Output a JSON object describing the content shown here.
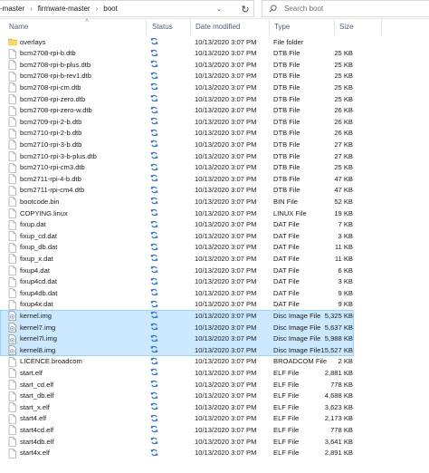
{
  "address_bar": {
    "crumbs": [
      "-master",
      "firmware-master",
      "boot"
    ],
    "separator": "›"
  },
  "search": {
    "placeholder": "Search boot"
  },
  "columns": {
    "name": "Name",
    "status": "Status",
    "date": "Date modified",
    "type": "Type",
    "size": "Size"
  },
  "colors": {
    "selection_bg": "#cce8ff",
    "selection_border": "#99d1ff",
    "folder": "#f4c64c",
    "sync_blue": "#2b6dd0"
  },
  "files": [
    {
      "name": "overlays",
      "date": "10/13/2020 3:07 PM",
      "type": "File folder",
      "size": "",
      "icon": "folder-icon",
      "selected": false
    },
    {
      "name": "bcm2708-rpi-b.dtb",
      "date": "10/13/2020 3:07 PM",
      "type": "DTB File",
      "size": "25 KB",
      "icon": "file-icon",
      "selected": false
    },
    {
      "name": "bcm2708-rpi-b-plus.dtb",
      "date": "10/13/2020 3:07 PM",
      "type": "DTB File",
      "size": "25 KB",
      "icon": "file-icon",
      "selected": false
    },
    {
      "name": "bcm2708-rpi-b-rev1.dtb",
      "date": "10/13/2020 3:07 PM",
      "type": "DTB File",
      "size": "25 KB",
      "icon": "file-icon",
      "selected": false
    },
    {
      "name": "bcm2708-rpi-cm.dtb",
      "date": "10/13/2020 3:07 PM",
      "type": "DTB File",
      "size": "25 KB",
      "icon": "file-icon",
      "selected": false
    },
    {
      "name": "bcm2708-rpi-zero.dtb",
      "date": "10/13/2020 3:07 PM",
      "type": "DTB File",
      "size": "25 KB",
      "icon": "file-icon",
      "selected": false
    },
    {
      "name": "bcm2708-rpi-zero-w.dtb",
      "date": "10/13/2020 3:07 PM",
      "type": "DTB File",
      "size": "26 KB",
      "icon": "file-icon",
      "selected": false
    },
    {
      "name": "bcm2709-rpi-2-b.dtb",
      "date": "10/13/2020 3:07 PM",
      "type": "DTB File",
      "size": "26 KB",
      "icon": "file-icon",
      "selected": false
    },
    {
      "name": "bcm2710-rpi-2-b.dtb",
      "date": "10/13/2020 3:07 PM",
      "type": "DTB File",
      "size": "26 KB",
      "icon": "file-icon",
      "selected": false
    },
    {
      "name": "bcm2710-rpi-3-b.dtb",
      "date": "10/13/2020 3:07 PM",
      "type": "DTB File",
      "size": "27 KB",
      "icon": "file-icon",
      "selected": false
    },
    {
      "name": "bcm2710-rpi-3-b-plus.dtb",
      "date": "10/13/2020 3:07 PM",
      "type": "DTB File",
      "size": "27 KB",
      "icon": "file-icon",
      "selected": false
    },
    {
      "name": "bcm2710-rpi-cm3.dtb",
      "date": "10/13/2020 3:07 PM",
      "type": "DTB File",
      "size": "25 KB",
      "icon": "file-icon",
      "selected": false
    },
    {
      "name": "bcm2711-rpi-4-b.dtb",
      "date": "10/13/2020 3:07 PM",
      "type": "DTB File",
      "size": "47 KB",
      "icon": "file-icon",
      "selected": false
    },
    {
      "name": "bcm2711-rpi-cm4.dtb",
      "date": "10/13/2020 3:07 PM",
      "type": "DTB File",
      "size": "47 KB",
      "icon": "file-icon",
      "selected": false
    },
    {
      "name": "bootcode.bin",
      "date": "10/13/2020 3:07 PM",
      "type": "BIN File",
      "size": "52 KB",
      "icon": "file-icon",
      "selected": false
    },
    {
      "name": "COPYING.linux",
      "date": "10/13/2020 3:07 PM",
      "type": "LINUX File",
      "size": "19 KB",
      "icon": "file-icon",
      "selected": false
    },
    {
      "name": "fixup.dat",
      "date": "10/13/2020 3:07 PM",
      "type": "DAT File",
      "size": "7 KB",
      "icon": "file-icon",
      "selected": false
    },
    {
      "name": "fixup_cd.dat",
      "date": "10/13/2020 3:07 PM",
      "type": "DAT File",
      "size": "3 KB",
      "icon": "file-icon",
      "selected": false
    },
    {
      "name": "fixup_db.dat",
      "date": "10/13/2020 3:07 PM",
      "type": "DAT File",
      "size": "11 KB",
      "icon": "file-icon",
      "selected": false
    },
    {
      "name": "fixup_x.dat",
      "date": "10/13/2020 3:07 PM",
      "type": "DAT File",
      "size": "11 KB",
      "icon": "file-icon",
      "selected": false
    },
    {
      "name": "fixup4.dat",
      "date": "10/13/2020 3:07 PM",
      "type": "DAT File",
      "size": "6 KB",
      "icon": "file-icon",
      "selected": false
    },
    {
      "name": "fixup4cd.dat",
      "date": "10/13/2020 3:07 PM",
      "type": "DAT File",
      "size": "3 KB",
      "icon": "file-icon",
      "selected": false
    },
    {
      "name": "fixup4db.dat",
      "date": "10/13/2020 3:07 PM",
      "type": "DAT File",
      "size": "9 KB",
      "icon": "file-icon",
      "selected": false
    },
    {
      "name": "fixup4x.dat",
      "date": "10/13/2020 3:07 PM",
      "type": "DAT File",
      "size": "9 KB",
      "icon": "file-icon",
      "selected": false
    },
    {
      "name": "kernel.img",
      "date": "10/13/2020 3:07 PM",
      "type": "Disc Image File",
      "size": "5,325 KB",
      "icon": "disc-image-icon",
      "selected": true
    },
    {
      "name": "kernel7.img",
      "date": "10/13/2020 3:07 PM",
      "type": "Disc Image File",
      "size": "5,637 KB",
      "icon": "disc-image-icon",
      "selected": true
    },
    {
      "name": "kernel7l.img",
      "date": "10/13/2020 3:07 PM",
      "type": "Disc Image File",
      "size": "5,988 KB",
      "icon": "disc-image-icon",
      "selected": true
    },
    {
      "name": "kernel8.img",
      "date": "10/13/2020 3:07 PM",
      "type": "Disc Image File",
      "size": "15,527 KB",
      "icon": "disc-image-icon",
      "selected": true
    },
    {
      "name": "LICENCE.broadcom",
      "date": "10/13/2020 3:07 PM",
      "type": "BROADCOM File",
      "size": "2 KB",
      "icon": "file-icon",
      "selected": false
    },
    {
      "name": "start.elf",
      "date": "10/13/2020 3:07 PM",
      "type": "ELF File",
      "size": "2,881 KB",
      "icon": "file-icon",
      "selected": false
    },
    {
      "name": "start_cd.elf",
      "date": "10/13/2020 3:07 PM",
      "type": "ELF File",
      "size": "778 KB",
      "icon": "file-icon",
      "selected": false
    },
    {
      "name": "start_db.elf",
      "date": "10/13/2020 3:07 PM",
      "type": "ELF File",
      "size": "4,688 KB",
      "icon": "file-icon",
      "selected": false
    },
    {
      "name": "start_x.elf",
      "date": "10/13/2020 3:07 PM",
      "type": "ELF File",
      "size": "3,623 KB",
      "icon": "file-icon",
      "selected": false
    },
    {
      "name": "start4.elf",
      "date": "10/13/2020 3:07 PM",
      "type": "ELF File",
      "size": "2,173 KB",
      "icon": "file-icon",
      "selected": false
    },
    {
      "name": "start4cd.elf",
      "date": "10/13/2020 3:07 PM",
      "type": "ELF File",
      "size": "778 KB",
      "icon": "file-icon",
      "selected": false
    },
    {
      "name": "start4db.elf",
      "date": "10/13/2020 3:07 PM",
      "type": "ELF File",
      "size": "3,641 KB",
      "icon": "file-icon",
      "selected": false
    },
    {
      "name": "start4x.elf",
      "date": "10/13/2020 3:07 PM",
      "type": "ELF File",
      "size": "2,891 KB",
      "icon": "file-icon",
      "selected": false
    }
  ]
}
